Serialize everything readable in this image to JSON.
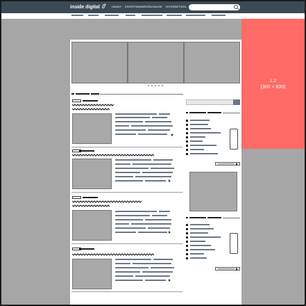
{
  "header": {
    "logo": "inside digital",
    "nav": [
      {
        "label": "HANDY"
      },
      {
        "label": "ENTERTAINMENT"
      },
      {
        "label": "ZUHAUSE"
      },
      {
        "label": "INTERNET/DSL"
      }
    ]
  },
  "ad": {
    "ratio": "1:2",
    "size": "(300 × 600)"
  },
  "colors": {
    "header": "#3c4a56",
    "ad": "#ff6b66",
    "placeholder": "#a8a8a8"
  }
}
